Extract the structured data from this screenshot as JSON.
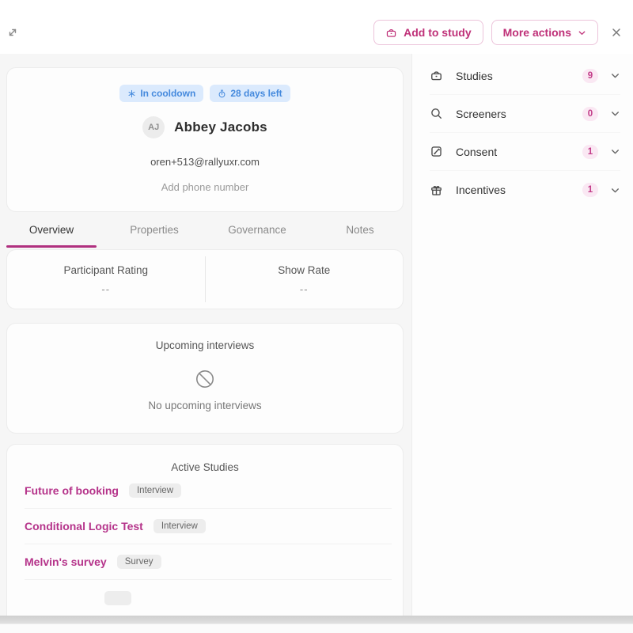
{
  "colors": {
    "brand_pink": "#bf3078",
    "link_pink": "#b5338a",
    "pink_badge_bg": "#fae8f3",
    "blue_badge_bg": "#dbeafd",
    "blue_badge_text": "#4489dd",
    "main_panel_bg": "#f6f6f6"
  },
  "icons": {
    "expand": "expand-icon (diagonal resize arrows)",
    "basket": "basket-icon (studies / add to study)",
    "chevron_down": "chevron-down-icon",
    "close": "close-icon (x)",
    "snowflake": "snowflake-icon (cooldown)",
    "timer": "timer-icon (days left)",
    "search": "search-icon (screeners)",
    "consent": "document-pen-icon (consent)",
    "gift": "gift-icon (incentives)",
    "prohibition": "no-entry-icon (empty state)"
  },
  "header": {
    "add_to_study_label": "Add to study",
    "more_actions_label": "More actions"
  },
  "profile": {
    "cooldown_badge": "In cooldown",
    "days_left_badge": "28 days left",
    "avatar_initials": "AJ",
    "name": "Abbey Jacobs",
    "email": "oren+513@rallyuxr.com",
    "phone_placeholder": "Add phone number"
  },
  "tabs": [
    {
      "label": "Overview",
      "active": true
    },
    {
      "label": "Properties",
      "active": false
    },
    {
      "label": "Governance",
      "active": false
    },
    {
      "label": "Notes",
      "active": false
    }
  ],
  "stats": {
    "participant_rating_label": "Participant Rating",
    "participant_rating_value": "--",
    "show_rate_label": "Show Rate",
    "show_rate_value": "--"
  },
  "upcoming": {
    "title": "Upcoming interviews",
    "empty_text": "No upcoming interviews"
  },
  "active_studies": {
    "title": "Active Studies",
    "items": [
      {
        "name": "Future of booking",
        "badge": "Interview"
      },
      {
        "name": "Conditional Logic Test",
        "badge": "Interview"
      },
      {
        "name": "Melvin's survey",
        "badge": "Survey"
      },
      {
        "name": "",
        "badge": ""
      }
    ]
  },
  "sidebar": {
    "items": [
      {
        "label": "Studies",
        "count": "9"
      },
      {
        "label": "Screeners",
        "count": "0"
      },
      {
        "label": "Consent",
        "count": "1"
      },
      {
        "label": "Incentives",
        "count": "1"
      }
    ]
  }
}
